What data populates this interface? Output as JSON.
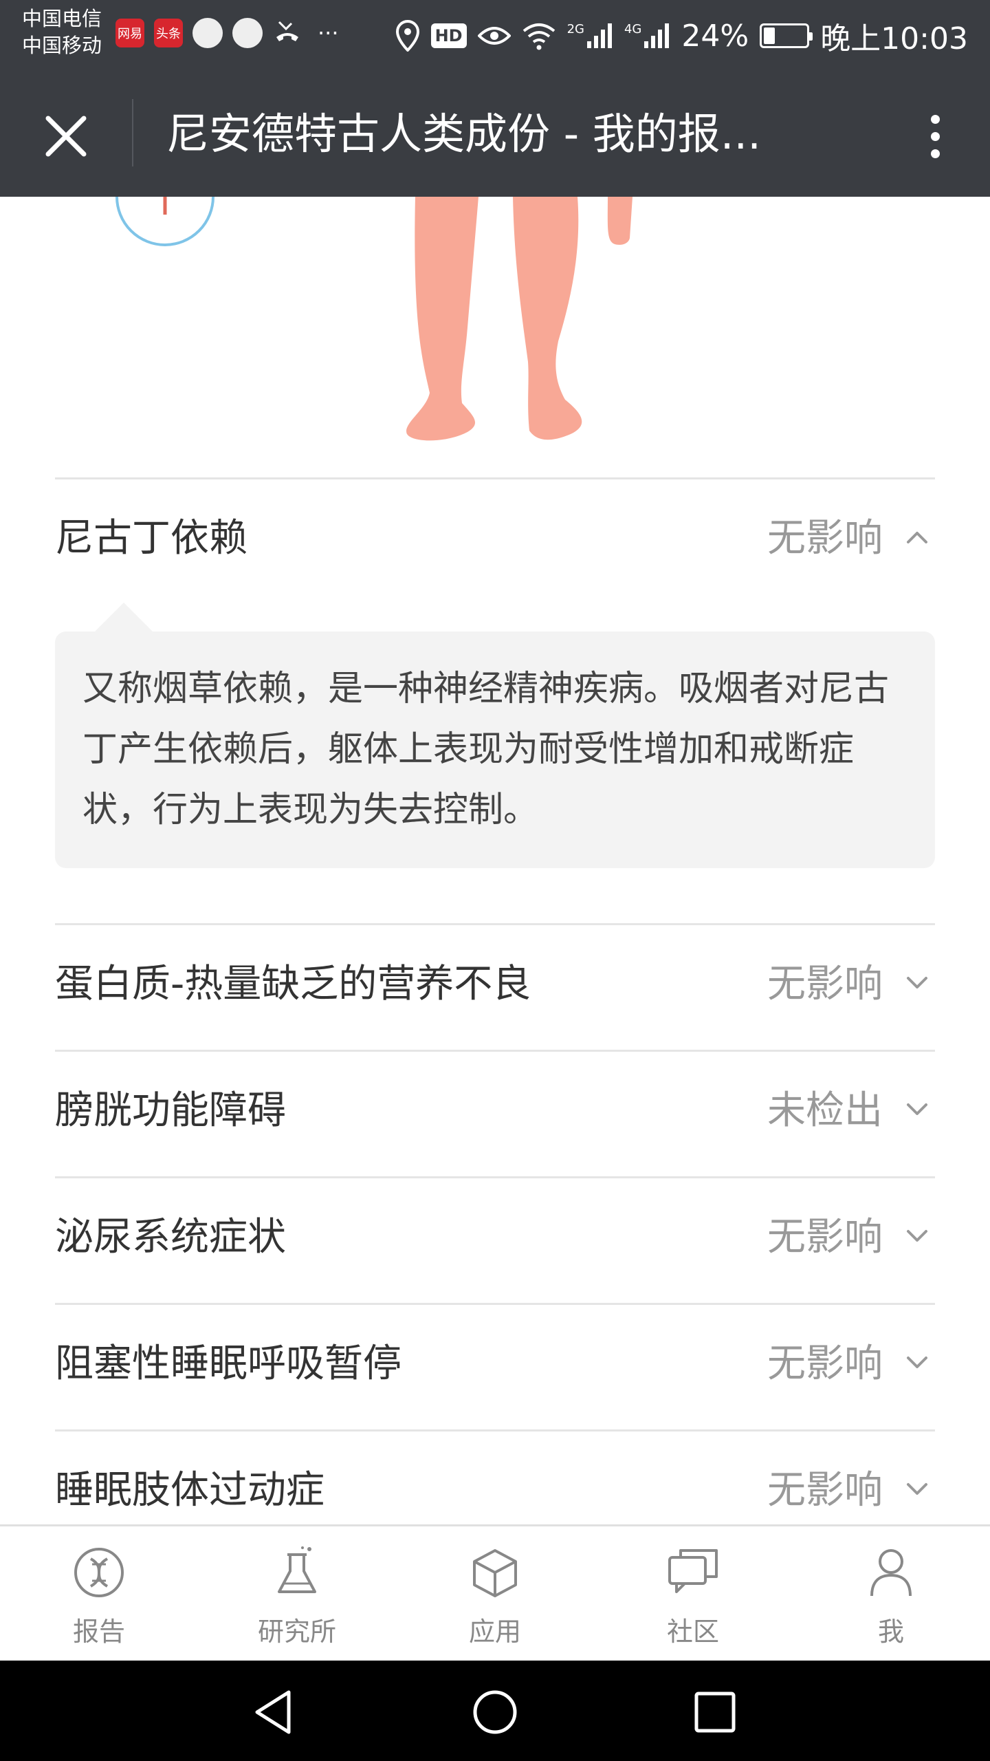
{
  "status_bar": {
    "carrier_1": "中国电信",
    "carrier_2": "中国移动",
    "app_badge_1": "网易",
    "app_badge_2": "头条",
    "more_dots": "···",
    "hd": "HD",
    "network_2g": "2G",
    "network_4g": "4G",
    "battery_pct": "24%",
    "time": "晚上10:03",
    "battery_level": 0.24
  },
  "title_bar": {
    "title": "尼安德特古人类成份 - 我的报..."
  },
  "expanded": {
    "name": "尼古丁依赖",
    "status": "无影响",
    "description": "又称烟草依赖，是一种神经精神疾病。吸烟者对尼古丁产生依赖后，躯体上表现为耐受性增加和戒断症状，行为上表现为失去控制。"
  },
  "rows": [
    {
      "name": "蛋白质-热量缺乏的营养不良",
      "status": "无影响"
    },
    {
      "name": "膀胱功能障碍",
      "status": "未检出"
    },
    {
      "name": "泌尿系统症状",
      "status": "无影响"
    },
    {
      "name": "阻塞性睡眠呼吸暂停",
      "status": "无影响"
    },
    {
      "name": "睡眠肢体过动症",
      "status": "无影响"
    }
  ],
  "bottom_nav": [
    {
      "label": "报告",
      "icon": "dna-icon"
    },
    {
      "label": "研究所",
      "icon": "flask-icon"
    },
    {
      "label": "应用",
      "icon": "cube-icon"
    },
    {
      "label": "社区",
      "icon": "chat-icon"
    },
    {
      "label": "我",
      "icon": "person-icon"
    }
  ],
  "colors": {
    "header_bg": "#3a3d42",
    "skin": "#f8a896",
    "muted_text": "#999999",
    "panel_bg": "#f3f3f3"
  }
}
